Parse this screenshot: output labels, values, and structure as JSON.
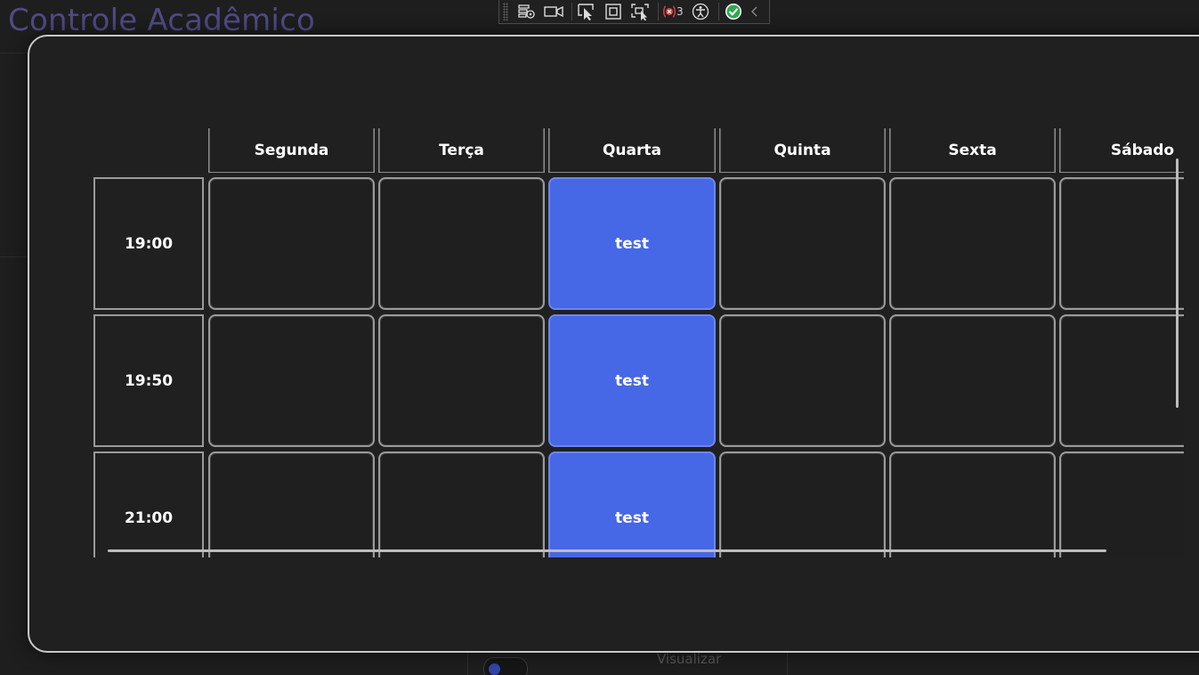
{
  "app": {
    "title": "Controle Acadêmico",
    "background_toggle_label": "Visualizar"
  },
  "debug_toolbar": {
    "icons": [
      "live-visual-tree-icon",
      "record-icon",
      "select-element-icon",
      "display-layout-adorners-icon",
      "track-focus-icon",
      "binding-failures-icon",
      "accessibility-icon",
      "checkmark-icon",
      "collapse-chevron-icon"
    ],
    "binding_failures_count": "3"
  },
  "schedule": {
    "days": [
      "Segunda",
      "Terça",
      "Quarta",
      "Quinta",
      "Sexta",
      "Sábado"
    ],
    "rows": [
      {
        "time": "19:00",
        "slots": [
          "",
          "",
          "test",
          "",
          "",
          ""
        ]
      },
      {
        "time": "19:50",
        "slots": [
          "",
          "",
          "test",
          "",
          "",
          ""
        ]
      },
      {
        "time": "21:00",
        "slots": [
          "",
          "",
          "test",
          "",
          "",
          ""
        ]
      }
    ]
  },
  "colors": {
    "accent_filled_slot": "#4667e6",
    "title_purple": "#4f4a86",
    "modal_border": "#c8c8c8",
    "background": "#1e1e1e"
  }
}
